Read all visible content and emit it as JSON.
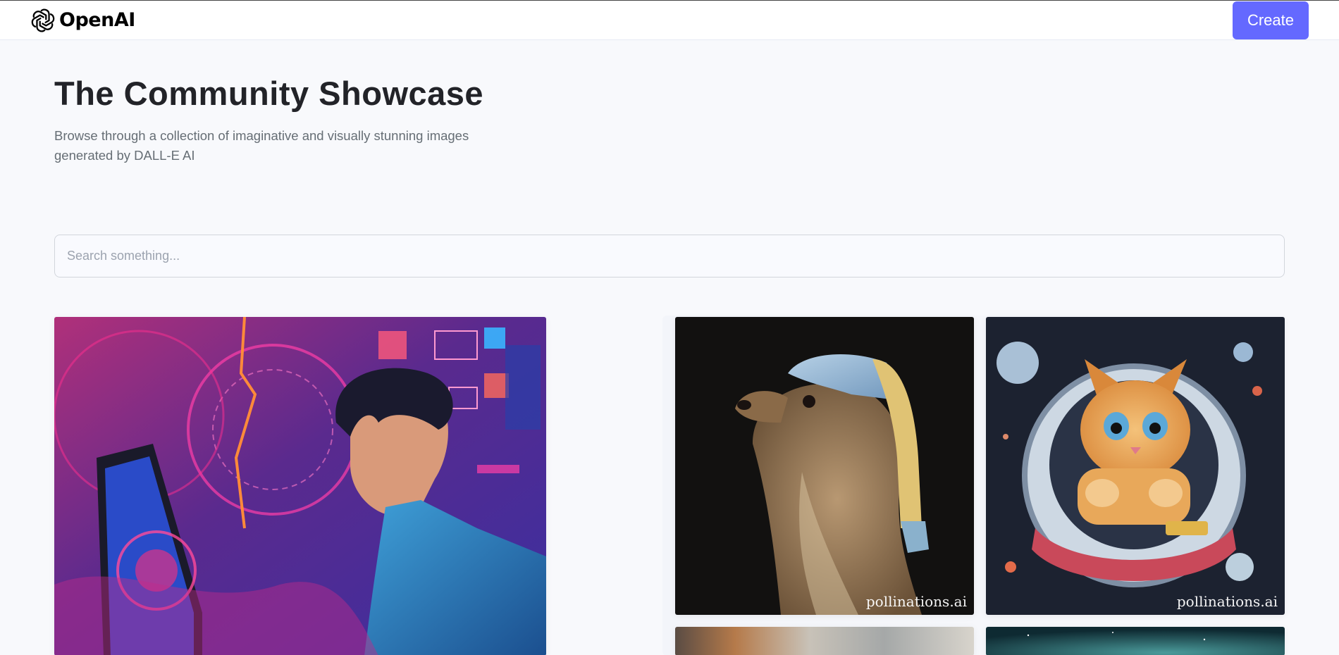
{
  "header": {
    "brand": "OpenAI",
    "create_label": "Create"
  },
  "hero": {
    "title": "The Community Showcase",
    "subtitle": "Browse through a collection of imaginative and visually stunning images generated by DALL-E AI"
  },
  "search": {
    "placeholder": "Search something...",
    "value": ""
  },
  "gallery": {
    "items": [
      {
        "subject": "man at computer, neon synthwave",
        "watermark": ""
      },
      {
        "subject": "otter wearing pearl-earring headscarf",
        "watermark": "pollinations.ai"
      },
      {
        "subject": "kitten in space capsule",
        "watermark": "pollinations.ai"
      },
      {
        "subject": "interior scene",
        "watermark": ""
      },
      {
        "subject": "teal night sky",
        "watermark": ""
      }
    ]
  },
  "colors": {
    "accent": "#6469ff",
    "background": "#f8f9fc",
    "title": "#222328",
    "subtitle": "#666e75"
  },
  "icons": {
    "logo": "openai-logo-icon"
  }
}
